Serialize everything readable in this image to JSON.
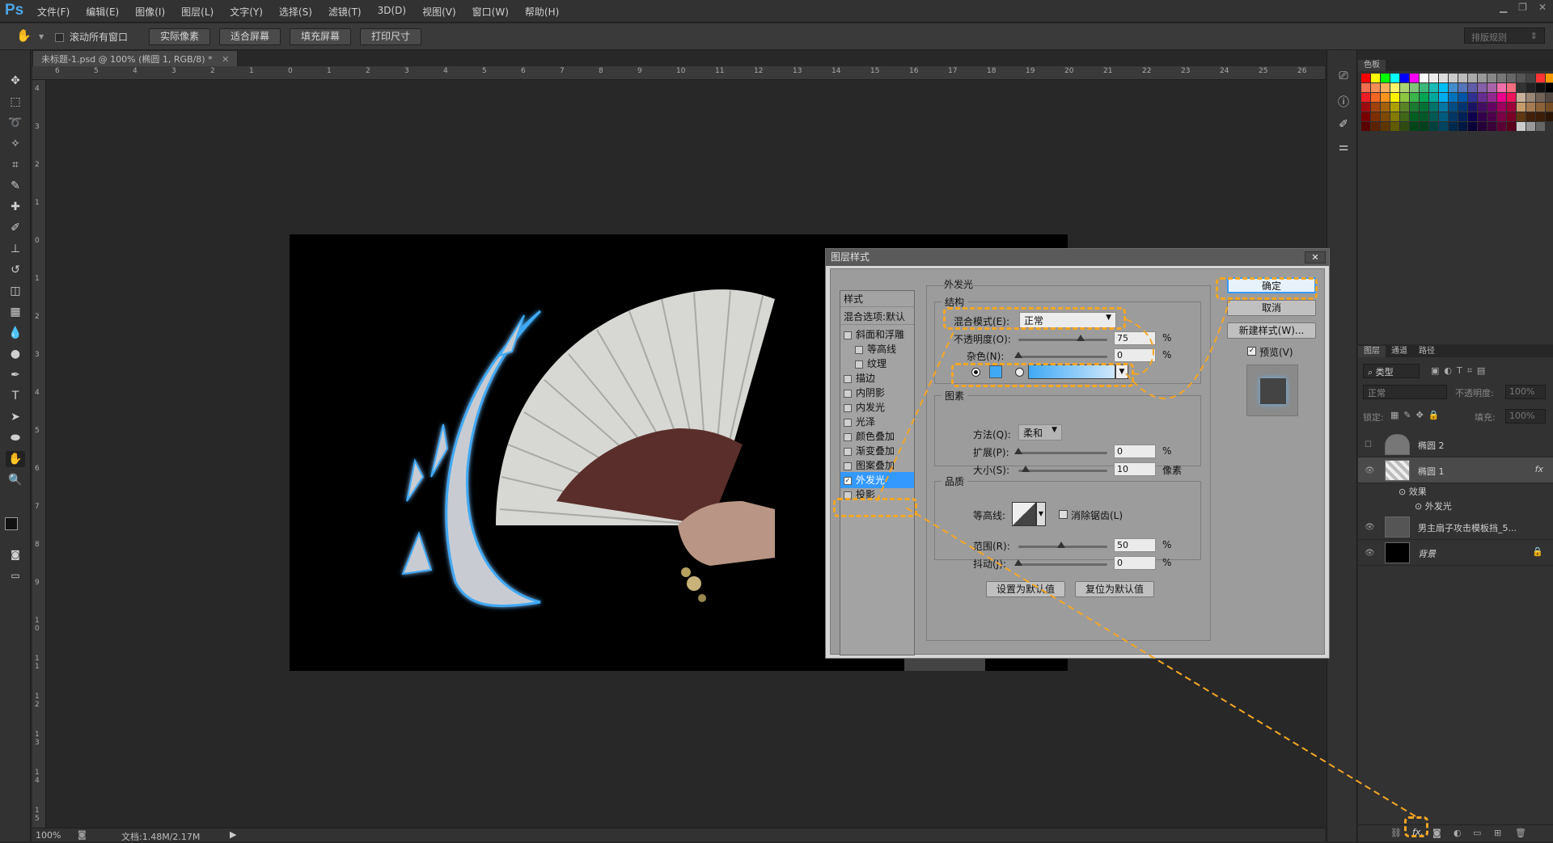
{
  "app": {
    "logo": "Ps"
  },
  "menu": [
    "文件(F)",
    "编辑(E)",
    "图像(I)",
    "图层(L)",
    "文字(Y)",
    "选择(S)",
    "滤镜(T)",
    "3D(D)",
    "视图(V)",
    "窗口(W)",
    "帮助(H)"
  ],
  "options": {
    "scroll_all": "滚动所有窗口",
    "btn_actual": "实际像素",
    "btn_fit": "适合屏幕",
    "btn_fill": "填充屏幕",
    "btn_print": "打印尺寸",
    "workspace": "排版规则"
  },
  "document": {
    "tab_title": "未标题-1.psd @ 100% (椭圆 1, RGB/8) *",
    "zoom": "100%",
    "doc_info": "文档:1.48M/2.17M"
  },
  "ruler": {
    "h_ticks": [
      "6",
      "5",
      "4",
      "3",
      "2",
      "1",
      "0",
      "1",
      "2",
      "3",
      "4",
      "5",
      "6",
      "7",
      "8",
      "9",
      "10",
      "11",
      "12",
      "13",
      "14",
      "15",
      "16",
      "17",
      "18",
      "19",
      "20",
      "21",
      "22",
      "23",
      "24",
      "25",
      "26"
    ],
    "v_ticks": [
      "4",
      "3",
      "2",
      "1",
      "0",
      "1",
      "2",
      "3",
      "4",
      "5",
      "6",
      "7",
      "8",
      "9",
      "1 0",
      "1 1",
      "1 2",
      "1 3",
      "1 4",
      "1 5"
    ]
  },
  "swatches": {
    "tab": "色板"
  },
  "layers": {
    "tabs": [
      "图层",
      "通道",
      "路径"
    ],
    "filter": "类型",
    "blend": "正常",
    "opacity_label": "不透明度:",
    "opacity": "100%",
    "lock_label": "锁定:",
    "fill_label": "填充:",
    "fill": "100%",
    "items": [
      {
        "name": "椭圆 2",
        "visible": false
      },
      {
        "name": "椭圆 1",
        "visible": true,
        "fx": "fx"
      },
      {
        "name": "效果",
        "sub": true
      },
      {
        "name": "外发光",
        "sub": true
      },
      {
        "name": "男主扇子攻击模板挡_5...",
        "visible": true
      },
      {
        "name": "背景",
        "visible": true,
        "locked": true
      }
    ],
    "bottom_fx": "fx."
  },
  "dialog": {
    "title": "图层样式",
    "close": "✕",
    "styles_header": "样式",
    "blend_options": "混合选项:默认",
    "style_items": [
      {
        "label": "斜面和浮雕",
        "checked": false,
        "indent": false
      },
      {
        "label": "等高线",
        "checked": false,
        "indent": true
      },
      {
        "label": "纹理",
        "checked": false,
        "indent": true
      },
      {
        "label": "描边",
        "checked": false,
        "indent": false
      },
      {
        "label": "内阴影",
        "checked": false,
        "indent": false
      },
      {
        "label": "内发光",
        "checked": false,
        "indent": false
      },
      {
        "label": "光泽",
        "checked": false,
        "indent": false
      },
      {
        "label": "颜色叠加",
        "checked": false,
        "indent": false
      },
      {
        "label": "渐变叠加",
        "checked": false,
        "indent": false
      },
      {
        "label": "图案叠加",
        "checked": false,
        "indent": false
      },
      {
        "label": "外发光",
        "checked": true,
        "indent": false,
        "selected": true
      },
      {
        "label": "投影",
        "checked": false,
        "indent": false
      }
    ],
    "section_title": "外发光",
    "structure": {
      "title": "结构",
      "blend_label": "混合模式(E):",
      "blend_value": "正常",
      "opacity_label": "不透明度(O):",
      "opacity": "75",
      "noise_label": "杂色(N):",
      "noise": "0",
      "pct": "%",
      "glow_color": "#3fa9f5"
    },
    "elements": {
      "title": "图素",
      "method_label": "方法(Q):",
      "method": "柔和",
      "spread_label": "扩展(P):",
      "spread": "0",
      "size_label": "大小(S):",
      "size": "10",
      "px": "像素"
    },
    "quality": {
      "title": "品质",
      "contour_label": "等高线:",
      "antialias": "消除锯齿(L)",
      "range_label": "范围(R):",
      "range": "50",
      "jitter_label": "抖动(J):",
      "jitter": "0"
    },
    "btn_make_default": "设置为默认值",
    "btn_reset_default": "复位为默认值",
    "ok": "确定",
    "cancel": "取消",
    "new_style": "新建样式(W)...",
    "preview": "预览(V)"
  },
  "colors": {
    "accent": "#f5a623",
    "selected": "#3399ff",
    "glow": "#3fa9f5"
  }
}
